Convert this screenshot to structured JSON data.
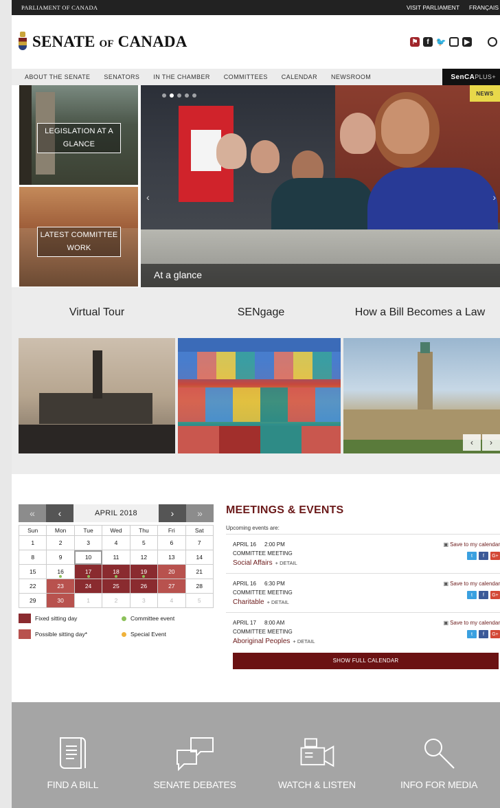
{
  "topbar": {
    "parliament": "PARLIAMENT OF CANADA",
    "visit": "VISIT PARLIAMENT",
    "lang": "FRANÇAIS"
  },
  "header": {
    "name_a": "SENATE",
    "name_b": "OF",
    "name_c": "CANADA"
  },
  "social": [
    "senca-icon",
    "facebook-icon",
    "twitter-icon",
    "instagram-icon",
    "youtube-icon",
    "search-icon"
  ],
  "nav": {
    "items": [
      "ABOUT THE SENATE",
      "SENATORS",
      "IN THE CHAMBER",
      "COMMITTEES",
      "CALENDAR",
      "NEWSROOM"
    ],
    "senca": "SenCA",
    "plus": "PLUS+"
  },
  "hero": {
    "tile1": "LEGISLATION AT A GLANCE",
    "tile2": "LATEST COMMITTEE WORK",
    "badge": "NEWS",
    "caption": "At a glance"
  },
  "features": [
    "Virtual Tour",
    "SENgage",
    "How a Bill Becomes a Law"
  ],
  "calendar": {
    "month": "APRIL 2018",
    "weekdays": [
      "Sun",
      "Mon",
      "Tue",
      "Wed",
      "Thu",
      "Fri",
      "Sat"
    ],
    "weeks": [
      [
        {
          "d": "1"
        },
        {
          "d": "2"
        },
        {
          "d": "3"
        },
        {
          "d": "4"
        },
        {
          "d": "5"
        },
        {
          "d": "6"
        },
        {
          "d": "7"
        }
      ],
      [
        {
          "d": "8"
        },
        {
          "d": "9"
        },
        {
          "d": "10",
          "s": "today"
        },
        {
          "d": "11"
        },
        {
          "d": "12"
        },
        {
          "d": "13"
        },
        {
          "d": "14"
        }
      ],
      [
        {
          "d": "15"
        },
        {
          "d": "16",
          "dot": true
        },
        {
          "d": "17",
          "s": "fixed",
          "dot": true
        },
        {
          "d": "18",
          "s": "fixed",
          "dot": true
        },
        {
          "d": "19",
          "s": "fixed",
          "dot": true
        },
        {
          "d": "20",
          "s": "poss"
        },
        {
          "d": "21"
        }
      ],
      [
        {
          "d": "22"
        },
        {
          "d": "23",
          "s": "poss"
        },
        {
          "d": "24",
          "s": "fixed"
        },
        {
          "d": "25",
          "s": "fixed"
        },
        {
          "d": "26",
          "s": "fixed"
        },
        {
          "d": "27",
          "s": "poss"
        },
        {
          "d": "28"
        }
      ],
      [
        {
          "d": "29"
        },
        {
          "d": "30",
          "s": "poss"
        },
        {
          "d": "1",
          "s": "other"
        },
        {
          "d": "2",
          "s": "other"
        },
        {
          "d": "3",
          "s": "other"
        },
        {
          "d": "4",
          "s": "other"
        },
        {
          "d": "5",
          "s": "other"
        }
      ]
    ],
    "legend": {
      "fixed": "Fixed sitting day",
      "committee": "Committee event",
      "possible": "Possible sitting day*",
      "special": "Special Event"
    },
    "colors": {
      "fixed": "#8a2b2f",
      "possible": "#b8524e",
      "committee": "#8cc15a",
      "special": "#f0b23a"
    }
  },
  "events": {
    "title": "MEETINGS & EVENTS",
    "subtitle": "Upcoming events are:",
    "save_label": "Save to my calendar",
    "detail_label": "+ DETAIL",
    "items": [
      {
        "date": "APRIL 16",
        "time": "2:00 PM",
        "type": "COMMITTEE MEETING",
        "name": "Social Affairs"
      },
      {
        "date": "APRIL 16",
        "time": "6:30 PM",
        "type": "COMMITTEE MEETING",
        "name": "Charitable"
      },
      {
        "date": "APRIL 17",
        "time": "8:00 AM",
        "type": "COMMITTEE MEETING",
        "name": "Aboriginal Peoples"
      }
    ],
    "full_calendar": "SHOW FULL CALENDAR"
  },
  "footer": [
    "FIND A BILL",
    "SENATE DEBATES",
    "WATCH & LISTEN",
    "INFO FOR MEDIA"
  ]
}
